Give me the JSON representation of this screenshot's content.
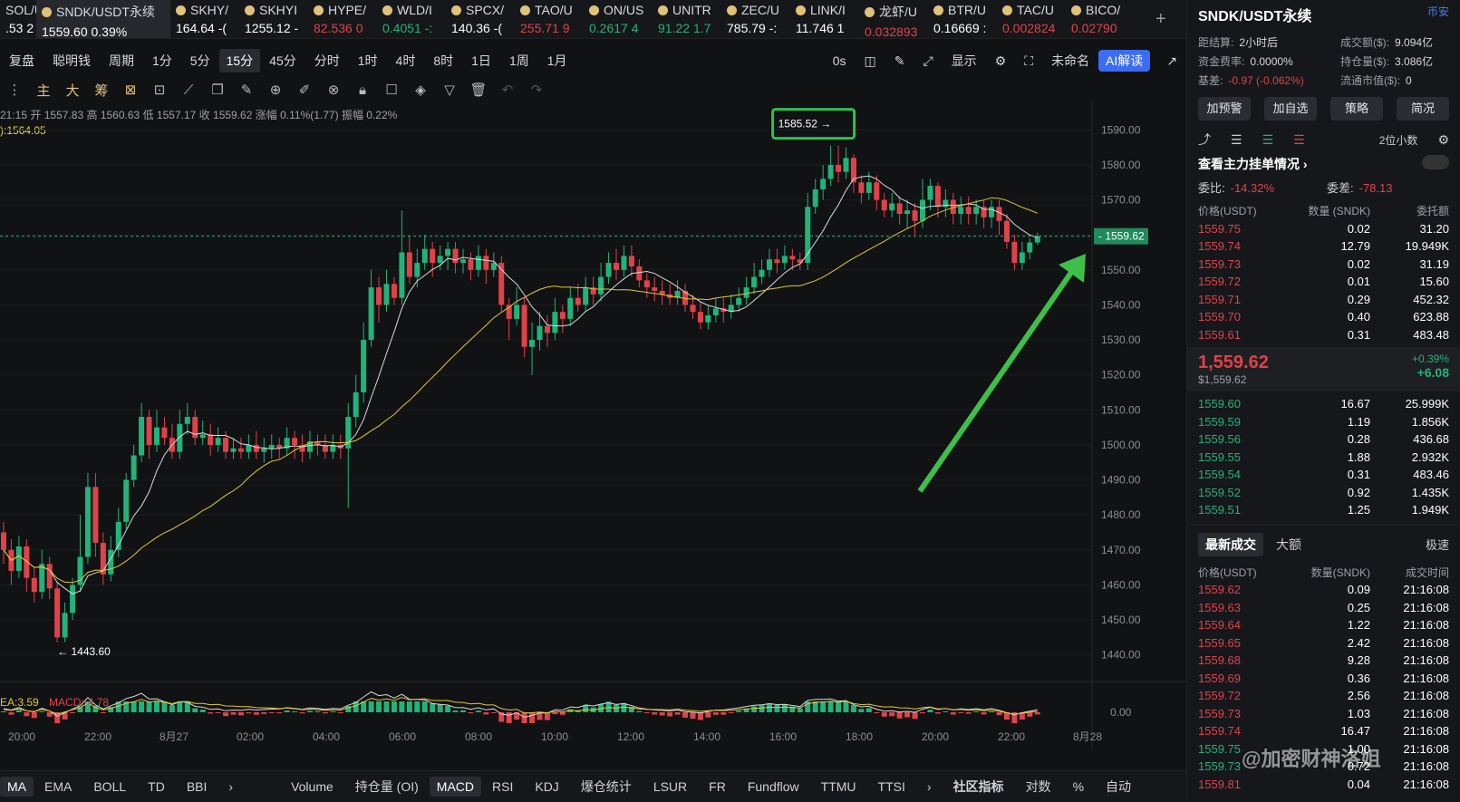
{
  "tickers": [
    {
      "name": "SOL/U",
      "price": ".53",
      "chg": "2",
      "chgc": "white",
      "w": 40,
      "dot": false
    },
    {
      "name": "SNDK/USDT永续",
      "price": "1559.60",
      "chg": "0.39%",
      "chgc": "white",
      "w": 148,
      "active": true
    },
    {
      "name": "SKHY/",
      "price": "164.64",
      "chg": "-(",
      "chgc": "white",
      "w": 76
    },
    {
      "name": "SKHYI",
      "price": "1255.12",
      "chg": "-",
      "chgc": "white",
      "w": 76
    },
    {
      "name": "HYPE/",
      "price": "82.536",
      "chg": "0",
      "chgc": "red",
      "w": 76
    },
    {
      "name": "WLD/I",
      "price": "0.4051",
      "chg": "-:",
      "chgc": "green",
      "w": 76
    },
    {
      "name": "SPCX/",
      "price": "140.36",
      "chg": "-(",
      "chgc": "white",
      "w": 76
    },
    {
      "name": "TAO/U",
      "price": "255.71",
      "chg": "9",
      "chgc": "red",
      "w": 76
    },
    {
      "name": "ON/US",
      "price": "0.2617",
      "chg": "4",
      "chgc": "green",
      "w": 76
    },
    {
      "name": "UNITR",
      "price": "91.22",
      "chg": "1.7",
      "chgc": "green",
      "w": 76
    },
    {
      "name": "ZEC/U",
      "price": "785.79",
      "chg": "-:",
      "chgc": "white",
      "w": 76
    },
    {
      "name": "LINK/I",
      "price": "11.746",
      "chg": "1",
      "chgc": "white",
      "w": 76
    },
    {
      "name": "龙虾/U",
      "price": "0.032893",
      "chg": "",
      "chgc": "red",
      "w": 76
    },
    {
      "name": "BTR/U",
      "price": "0.16669",
      "chg": ":",
      "chgc": "white",
      "w": 76
    },
    {
      "name": "TAC/U",
      "price": "0.002824",
      "chg": "",
      "chgc": "red",
      "w": 76
    },
    {
      "name": "BICO/",
      "price": "0.02790",
      "chg": "",
      "chgc": "red",
      "w": 70
    }
  ],
  "plus": "+",
  "toolbar1": [
    "复盘",
    "聪明钱",
    "周期",
    "1分",
    "5分",
    "15分",
    "45分",
    "分时",
    "1时",
    "4时",
    "8时",
    "1日",
    "1周",
    "1月"
  ],
  "toolbar1_selected": "15分",
  "toolbar1_right": [
    "0s",
    "未命名",
    "AI解读"
  ],
  "display_label": "显示",
  "toolbar2": [
    "主",
    "大",
    "筹"
  ],
  "info": {
    "time": "21:15",
    "open_l": "开",
    "open": "1557.83",
    "high_l": "高",
    "high": "1560.63",
    "low_l": "低",
    "low": "1557.17",
    "close_l": "收",
    "close": "1559.62",
    "chg_l": "涨幅",
    "chg": "0.11%(1.77)",
    "amp_l": "振幅",
    "amp": "0.22%"
  },
  "ma_text": "):1564.05",
  "chart_data": {
    "type": "candlestick",
    "ylim": [
      1435,
      1595
    ],
    "yticks": [
      "1590.00",
      "1580.00",
      "1570.00",
      "1560.00",
      "1550.00",
      "1540.00",
      "1530.00",
      "1520.00",
      "1510.00",
      "1500.00",
      "1490.00",
      "1480.00",
      "1470.00",
      "1460.00",
      "1450.00",
      "1440.00"
    ],
    "xticks": [
      "20:00",
      "22:00",
      "8月27",
      "02:00",
      "04:00",
      "06:00",
      "08:00",
      "10:00",
      "12:00",
      "14:00",
      "16:00",
      "18:00",
      "20:00",
      "22:00",
      "8月28"
    ],
    "last_price": "1559.62",
    "high_marker": "1585.52",
    "low_marker": "1443.60",
    "macd_zero": "0.00",
    "candles": [
      [
        1475,
        1470,
        1478,
        1466
      ],
      [
        1470,
        1464,
        1473,
        1460
      ],
      [
        1464,
        1471,
        1474,
        1462
      ],
      [
        1471,
        1462,
        1473,
        1458
      ],
      [
        1462,
        1458,
        1465,
        1455
      ],
      [
        1458,
        1466,
        1470,
        1456
      ],
      [
        1466,
        1459,
        1468,
        1456
      ],
      [
        1459,
        1445,
        1461,
        1443.6
      ],
      [
        1445,
        1452,
        1455,
        1443.6
      ],
      [
        1452,
        1460,
        1462,
        1450
      ],
      [
        1460,
        1468,
        1480,
        1458
      ],
      [
        1468,
        1488,
        1492,
        1466
      ],
      [
        1488,
        1472,
        1492,
        1468
      ],
      [
        1472,
        1463,
        1475,
        1460
      ],
      [
        1463,
        1470,
        1474,
        1461
      ],
      [
        1470,
        1478,
        1482,
        1468
      ],
      [
        1478,
        1490,
        1492,
        1476
      ],
      [
        1490,
        1497,
        1500,
        1488
      ],
      [
        1497,
        1508,
        1512,
        1495
      ],
      [
        1508,
        1500,
        1510,
        1496
      ],
      [
        1500,
        1505,
        1510,
        1498
      ],
      [
        1505,
        1502,
        1508,
        1500
      ],
      [
        1502,
        1498,
        1506,
        1496
      ],
      [
        1498,
        1506,
        1510,
        1496
      ],
      [
        1506,
        1508,
        1512,
        1503
      ],
      [
        1508,
        1502,
        1510,
        1500
      ],
      [
        1502,
        1503,
        1507,
        1500
      ],
      [
        1503,
        1500,
        1506,
        1497
      ],
      [
        1500,
        1502,
        1505,
        1498
      ],
      [
        1502,
        1498,
        1504,
        1496
      ],
      [
        1498,
        1499,
        1502,
        1496
      ],
      [
        1499,
        1498,
        1502,
        1496
      ],
      [
        1498,
        1500,
        1503,
        1496
      ],
      [
        1500,
        1498,
        1504,
        1496
      ],
      [
        1498,
        1499,
        1502,
        1495
      ],
      [
        1499,
        1500,
        1503,
        1496
      ],
      [
        1500,
        1499,
        1502,
        1496
      ],
      [
        1499,
        1502,
        1505,
        1497
      ],
      [
        1502,
        1500,
        1504,
        1496
      ],
      [
        1500,
        1498,
        1503,
        1495
      ],
      [
        1498,
        1501,
        1504,
        1496
      ],
      [
        1501,
        1500,
        1503,
        1497
      ],
      [
        1500,
        1498,
        1503,
        1496
      ],
      [
        1498,
        1500,
        1503,
        1496
      ],
      [
        1500,
        1499,
        1503,
        1496
      ],
      [
        1499,
        1508,
        1512,
        1482
      ],
      [
        1508,
        1515,
        1520,
        1505
      ],
      [
        1515,
        1530,
        1535,
        1512
      ],
      [
        1530,
        1545,
        1550,
        1528
      ],
      [
        1545,
        1540,
        1548,
        1535
      ],
      [
        1540,
        1546,
        1550,
        1538
      ],
      [
        1546,
        1542,
        1548,
        1540
      ],
      [
        1542,
        1555,
        1567,
        1540
      ],
      [
        1555,
        1548,
        1560,
        1546
      ],
      [
        1548,
        1552,
        1556,
        1545
      ],
      [
        1552,
        1556,
        1560,
        1550
      ],
      [
        1556,
        1552,
        1558,
        1548
      ],
      [
        1552,
        1554,
        1557,
        1550
      ],
      [
        1554,
        1556,
        1558,
        1550
      ],
      [
        1556,
        1552,
        1558,
        1549
      ],
      [
        1552,
        1553,
        1556,
        1549
      ],
      [
        1553,
        1550,
        1555,
        1547
      ],
      [
        1550,
        1554,
        1557,
        1548
      ],
      [
        1554,
        1550,
        1556,
        1546
      ],
      [
        1550,
        1552,
        1555,
        1548
      ],
      [
        1552,
        1540,
        1554,
        1538
      ],
      [
        1540,
        1536,
        1542,
        1530
      ],
      [
        1536,
        1540,
        1545,
        1534
      ],
      [
        1540,
        1528,
        1542,
        1525
      ],
      [
        1528,
        1530,
        1535,
        1520
      ],
      [
        1530,
        1534,
        1538,
        1527
      ],
      [
        1534,
        1532,
        1537,
        1528
      ],
      [
        1532,
        1538,
        1542,
        1530
      ],
      [
        1538,
        1536,
        1540,
        1532
      ],
      [
        1536,
        1542,
        1545,
        1534
      ],
      [
        1542,
        1540,
        1546,
        1538
      ],
      [
        1540,
        1545,
        1548,
        1538
      ],
      [
        1545,
        1543,
        1548,
        1540
      ],
      [
        1543,
        1548,
        1552,
        1541
      ],
      [
        1548,
        1552,
        1555,
        1546
      ],
      [
        1552,
        1550,
        1556,
        1547
      ],
      [
        1550,
        1554,
        1557,
        1548
      ],
      [
        1554,
        1551,
        1557,
        1548
      ],
      [
        1551,
        1547,
        1553,
        1545
      ],
      [
        1547,
        1545,
        1549,
        1542
      ],
      [
        1545,
        1544,
        1548,
        1541
      ],
      [
        1544,
        1543,
        1547,
        1540
      ],
      [
        1543,
        1542,
        1546,
        1540
      ],
      [
        1542,
        1544,
        1547,
        1540
      ],
      [
        1544,
        1540,
        1546,
        1538
      ],
      [
        1540,
        1538,
        1543,
        1536
      ],
      [
        1538,
        1535,
        1541,
        1533
      ],
      [
        1535,
        1537,
        1540,
        1533
      ],
      [
        1537,
        1539,
        1542,
        1535
      ],
      [
        1539,
        1538,
        1542,
        1535
      ],
      [
        1538,
        1540,
        1543,
        1536
      ],
      [
        1540,
        1542,
        1545,
        1538
      ],
      [
        1542,
        1545,
        1548,
        1540
      ],
      [
        1545,
        1548,
        1552,
        1543
      ],
      [
        1548,
        1550,
        1553,
        1546
      ],
      [
        1550,
        1553,
        1556,
        1548
      ],
      [
        1553,
        1552,
        1556,
        1549
      ],
      [
        1552,
        1554,
        1557,
        1550
      ],
      [
        1554,
        1553,
        1556,
        1550
      ],
      [
        1553,
        1552,
        1555,
        1550
      ],
      [
        1552,
        1568,
        1572,
        1550
      ],
      [
        1568,
        1573,
        1576,
        1566
      ],
      [
        1573,
        1576,
        1580,
        1570
      ],
      [
        1576,
        1580,
        1585.52,
        1574
      ],
      [
        1580,
        1578,
        1585.52,
        1575
      ],
      [
        1578,
        1582,
        1585,
        1576
      ],
      [
        1582,
        1575,
        1583,
        1572
      ],
      [
        1575,
        1572,
        1577,
        1569
      ],
      [
        1572,
        1575,
        1578,
        1570
      ],
      [
        1575,
        1570,
        1577,
        1567
      ],
      [
        1570,
        1567,
        1572,
        1565
      ],
      [
        1567,
        1569,
        1572,
        1565
      ],
      [
        1569,
        1566,
        1571,
        1563
      ],
      [
        1566,
        1567,
        1570,
        1562
      ],
      [
        1567,
        1564,
        1569,
        1560
      ],
      [
        1564,
        1570,
        1576,
        1562
      ],
      [
        1570,
        1574,
        1576,
        1567
      ],
      [
        1574,
        1568,
        1575,
        1565
      ],
      [
        1568,
        1570,
        1573,
        1565
      ],
      [
        1570,
        1566,
        1572,
        1563
      ],
      [
        1566,
        1568,
        1571,
        1563
      ],
      [
        1568,
        1566,
        1571,
        1563
      ],
      [
        1566,
        1568,
        1570,
        1563
      ],
      [
        1568,
        1565,
        1570,
        1562
      ],
      [
        1565,
        1568,
        1570,
        1562
      ],
      [
        1568,
        1564,
        1570,
        1560
      ],
      [
        1564,
        1558,
        1566,
        1556
      ],
      [
        1558,
        1552,
        1560,
        1550
      ],
      [
        1552,
        1555,
        1558,
        1550
      ],
      [
        1555,
        1557.83,
        1559,
        1553
      ],
      [
        1557.83,
        1559.62,
        1560.63,
        1557.17
      ]
    ]
  },
  "macd": {
    "ema_label": "EA:3.59",
    "macd_label": "MACD:-4.78"
  },
  "indicators_left": [
    "MA",
    "EMA",
    "BOLL",
    "TD",
    "BBI"
  ],
  "indicators_right": [
    "Volume",
    "持仓量 (OI)",
    "MACD",
    "RSI",
    "KDJ",
    "爆仓统计",
    "LSUR",
    "FR",
    "Fundflow",
    "TTMU",
    "TTSI"
  ],
  "indicator_selected": "MACD",
  "ind_extra": [
    "社区指标",
    "对数",
    "%",
    "自动"
  ],
  "right_panel": {
    "title": "SNDK/USDT永续",
    "exchange": "币安",
    "stats": [
      [
        "距结算:",
        "2小时后",
        "成交额($):",
        "9.094亿"
      ],
      [
        "资金费率:",
        "0.0000%",
        "持仓量($):",
        "3.086亿"
      ],
      [
        "基差:",
        "-0.97 (-0.062%)",
        "流通市值($):",
        "0"
      ]
    ],
    "buttons": [
      "加预警",
      "加自选",
      "策略",
      "简况"
    ],
    "precision": "2位小数",
    "main_orders": "查看主力挂单情况",
    "ratio_label": "委比:",
    "ratio": "-14.32%",
    "diff_label": "委差:",
    "diff": "-78.13",
    "ob_headers": [
      "价格(USDT)",
      "数量 (SNDK)",
      "委托额"
    ],
    "asks": [
      [
        "1559.75",
        "0.02",
        "31.20"
      ],
      [
        "1559.74",
        "12.79",
        "19.949K"
      ],
      [
        "1559.73",
        "0.02",
        "31.19"
      ],
      [
        "1559.72",
        "0.01",
        "15.60"
      ],
      [
        "1559.71",
        "0.29",
        "452.32"
      ],
      [
        "1559.70",
        "0.40",
        "623.88"
      ],
      [
        "1559.61",
        "0.31",
        "483.48"
      ]
    ],
    "last": "1,559.62",
    "last_usd": "$1,559.62",
    "last_pct": "+0.39%",
    "last_chg": "+6.08",
    "bids": [
      [
        "1559.60",
        "16.67",
        "25.999K"
      ],
      [
        "1559.59",
        "1.19",
        "1.856K"
      ],
      [
        "1559.56",
        "0.28",
        "436.68"
      ],
      [
        "1559.55",
        "1.88",
        "2.932K"
      ],
      [
        "1559.54",
        "0.31",
        "483.46"
      ],
      [
        "1559.52",
        "0.92",
        "1.435K"
      ],
      [
        "1559.51",
        "1.25",
        "1.949K"
      ]
    ],
    "trade_tabs": [
      "最新成交",
      "大额"
    ],
    "fast": "极速",
    "trade_headers": [
      "价格(USDT)",
      "数量(SNDK)",
      "成交时间"
    ],
    "trades": [
      [
        "1559.62",
        "0.09",
        "21:16:08",
        "red"
      ],
      [
        "1559.63",
        "0.25",
        "21:16:08",
        "red"
      ],
      [
        "1559.64",
        "1.22",
        "21:16:08",
        "red"
      ],
      [
        "1559.65",
        "2.42",
        "21:16:08",
        "red"
      ],
      [
        "1559.68",
        "9.28",
        "21:16:08",
        "red"
      ],
      [
        "1559.69",
        "0.36",
        "21:16:08",
        "red"
      ],
      [
        "1559.72",
        "2.56",
        "21:16:08",
        "red"
      ],
      [
        "1559.73",
        "1.03",
        "21:16:08",
        "red"
      ],
      [
        "1559.74",
        "16.47",
        "21:16:08",
        "red"
      ],
      [
        "1559.75",
        "1.00",
        "21:16:08",
        "green"
      ],
      [
        "1559.73",
        "0.72",
        "21:16:08",
        "green"
      ],
      [
        "1559.81",
        "0.04",
        "21:16:08",
        "red"
      ]
    ]
  },
  "watermark": "@加密财神洛姐",
  "colors": {
    "up": "#21b37a",
    "down": "#e0424a",
    "ma1": "#d9d9d9",
    "ma2": "#e3c830",
    "arrow": "#3dbf4a",
    "accent": "#3b6cf2"
  }
}
